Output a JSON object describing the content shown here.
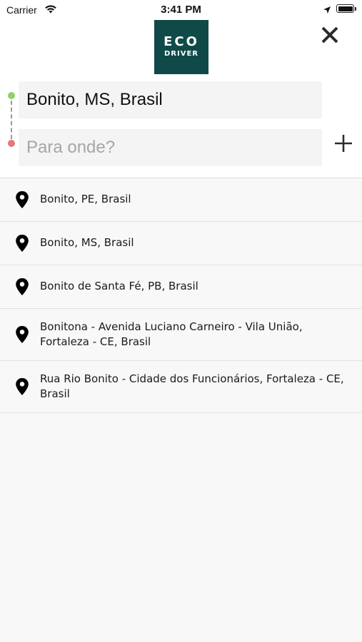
{
  "status_bar": {
    "carrier": "Carrier",
    "time": "3:41 PM"
  },
  "logo": {
    "line1": "ECO",
    "line2": "DRIVER",
    "background": "#0f4a48"
  },
  "route": {
    "origin_value": "Bonito, MS, Brasil",
    "destination_placeholder": "Para onde?",
    "origin_dot_color": "#8fd16a",
    "destination_dot_color": "#e57777"
  },
  "results": [
    {
      "label": "Bonito, PE, Brasil"
    },
    {
      "label": "Bonito, MS, Brasil"
    },
    {
      "label": "Bonito de Santa Fé, PB, Brasil"
    },
    {
      "label": "Bonitona - Avenida Luciano Carneiro - Vila União, Fortaleza - CE, Brasil"
    },
    {
      "label": "Rua Rio Bonito - Cidade dos Funcionários, Fortaleza - CE, Brasil"
    }
  ],
  "icons": {
    "close": "close-icon",
    "add": "plus-icon",
    "result": "map-pin-icon"
  }
}
